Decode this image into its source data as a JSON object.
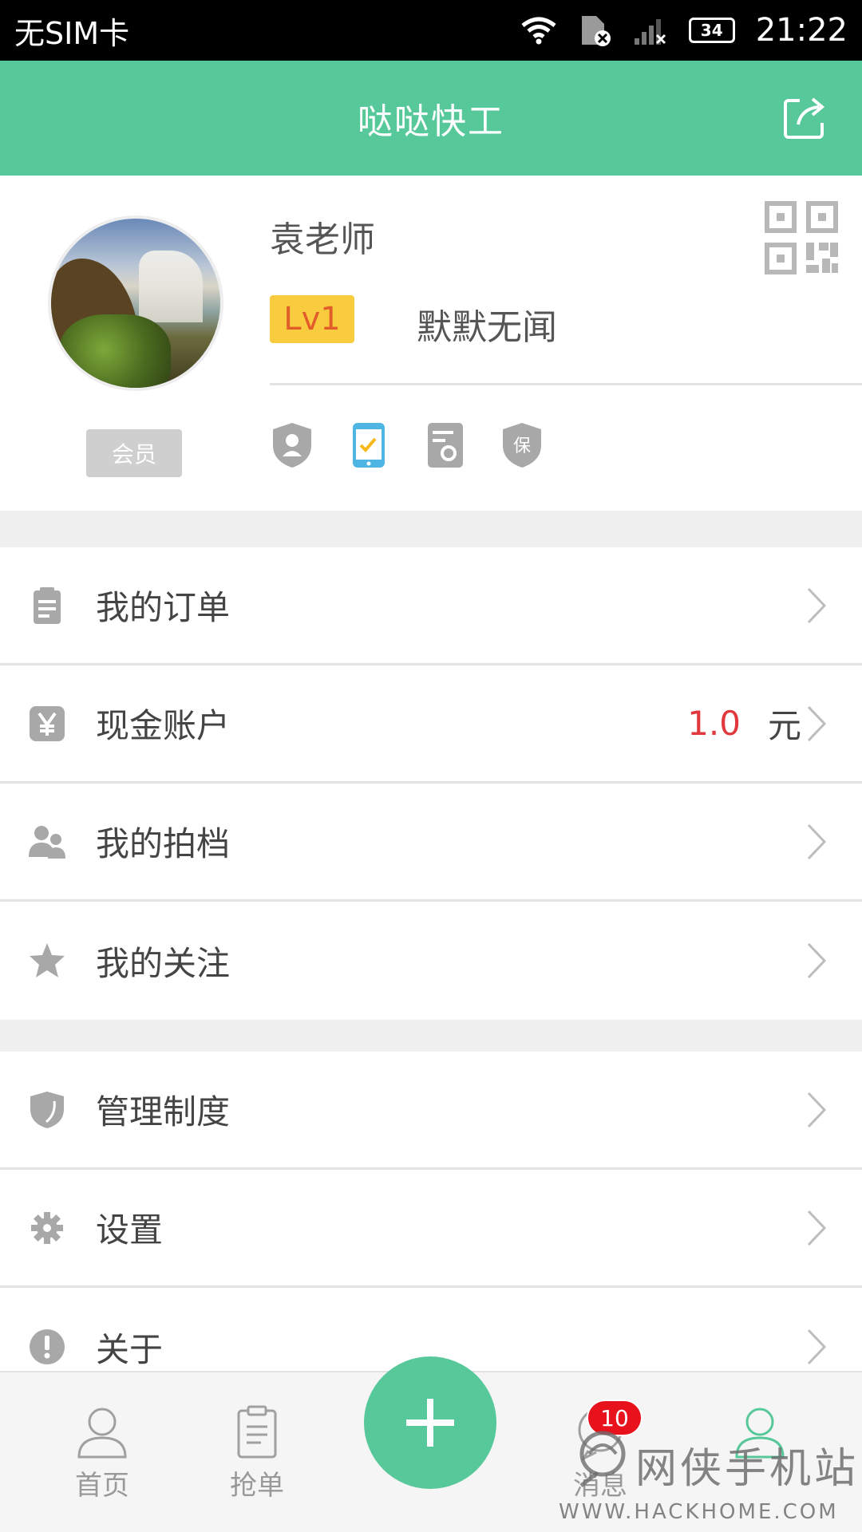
{
  "status_bar": {
    "carrier": "无SIM卡",
    "battery": "34",
    "time": "21:22"
  },
  "title_bar": {
    "title": "哒哒快工",
    "share_icon": "share-icon"
  },
  "profile": {
    "username": "袁老师",
    "membership_label": "会员",
    "level": "Lv1",
    "level_title": "默默无闻",
    "badges": [
      "identity-shield-icon",
      "phone-verified-icon",
      "certificate-icon",
      "insurance-shield-icon"
    ],
    "insurance_char": "保"
  },
  "menu": {
    "group1": [
      {
        "label": "我的订单",
        "icon": "clipboard-icon"
      },
      {
        "label": "现金账户",
        "icon": "yen-icon",
        "value": "1.0",
        "unit": "元"
      },
      {
        "label": "我的拍档",
        "icon": "partners-icon"
      },
      {
        "label": "我的关注",
        "icon": "star-icon"
      }
    ],
    "group2": [
      {
        "label": "管理制度",
        "icon": "shield-icon"
      },
      {
        "label": "设置",
        "icon": "gear-icon"
      },
      {
        "label": "关于",
        "icon": "info-icon"
      }
    ]
  },
  "tabs": [
    {
      "label": "首页",
      "icon": "home-person-icon"
    },
    {
      "label": "抢单",
      "icon": "clipboard-icon"
    },
    {
      "label": "消息",
      "icon": "message-icon",
      "badge": "10"
    }
  ],
  "watermark": {
    "text": "网侠手机站",
    "url": "WWW.HACKHOME.COM"
  },
  "colors": {
    "accent": "#56c899",
    "level_bg": "#f9cc3f",
    "level_text": "#e25d2a",
    "amount": "#e0383c",
    "badge": "#e8121d"
  }
}
